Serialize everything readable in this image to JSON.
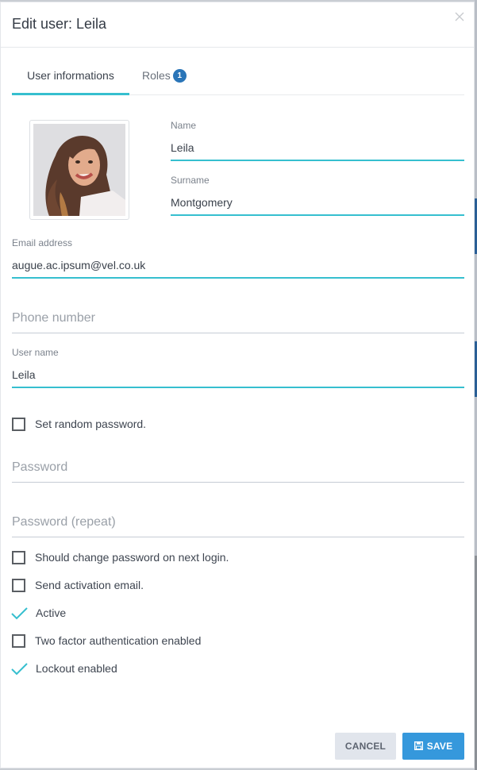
{
  "modal": {
    "title": "Edit user: Leila",
    "close_icon": "close-icon"
  },
  "tabs": [
    {
      "label": "User informations",
      "active": true
    },
    {
      "label": "Roles",
      "badge": "1",
      "active": false
    }
  ],
  "profile_picture": {
    "alt": "User profile photo"
  },
  "fields": {
    "name": {
      "label": "Name",
      "value": "Leila"
    },
    "surname": {
      "label": "Surname",
      "value": "Montgomery"
    },
    "email": {
      "label": "Email address",
      "value": "augue.ac.ipsum@vel.co.uk"
    },
    "phone": {
      "placeholder": "Phone number",
      "value": ""
    },
    "username": {
      "label": "User name",
      "value": "Leila"
    },
    "password": {
      "placeholder": "Password",
      "value": ""
    },
    "password_repeat": {
      "placeholder": "Password (repeat)",
      "value": ""
    }
  },
  "checkboxes": {
    "set_random_password": {
      "label": "Set random password.",
      "checked": false
    },
    "should_change_password": {
      "label": "Should change password on next login.",
      "checked": false
    },
    "send_activation_email": {
      "label": "Send activation email.",
      "checked": false
    },
    "active": {
      "label": "Active",
      "checked": true
    },
    "two_factor": {
      "label": "Two factor authentication enabled",
      "checked": false
    },
    "lockout": {
      "label": "Lockout enabled",
      "checked": true
    }
  },
  "buttons": {
    "cancel": "CANCEL",
    "save": "SAVE"
  },
  "colors": {
    "accent": "#36bfcf",
    "primary": "#3598dc",
    "badge": "#2a75b8"
  }
}
